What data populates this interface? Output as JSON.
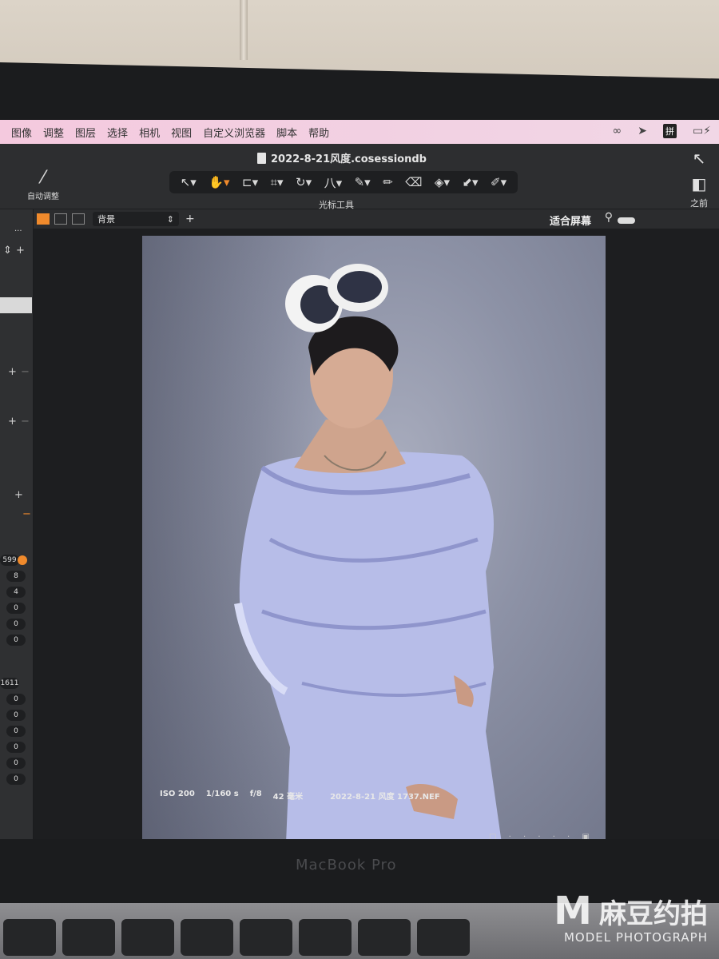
{
  "menubar": {
    "items": [
      "图像",
      "调整",
      "图层",
      "选择",
      "相机",
      "视图",
      "自定义浏览器",
      "脚本",
      "帮助"
    ],
    "tray": [
      "creative-cloud-icon",
      "send-icon",
      "拼",
      "battery-charging-icon"
    ],
    "tray_input_label": "拼"
  },
  "window": {
    "title": "2022-8-21风度.cosessiondb",
    "auto_adjust_label": "自动调整",
    "tool_caption": "光标工具",
    "before_label": "之前"
  },
  "toolbar": {
    "tools": [
      "select-icon",
      "pan-hand-icon",
      "loupe-icon",
      "crop-icon",
      "rotate-icon",
      "keystone-icon",
      "brush-icon",
      "eraser-icon",
      "gradient-icon",
      "stamp-icon",
      "picker-icon",
      "annotation-icon"
    ],
    "glyphs": [
      "↖▾",
      "✋▾",
      "⊏▾",
      "⌗▾",
      "↻▾",
      "八▾",
      "✎▾",
      "✏",
      "⌫",
      "◈▾",
      "⬋▾",
      "✐▾"
    ],
    "active_index": 1
  },
  "viewer": {
    "layer_select_value": "背景",
    "fit_label": "适合屏幕",
    "add_glyph": "+"
  },
  "left_panel": {
    "counts_upper": [
      "599",
      "8",
      "4",
      "0",
      "0",
      "0"
    ],
    "counts_lower": [
      "1611",
      "0",
      "0",
      "0",
      "0",
      "0",
      "0"
    ],
    "add_glyph": "+",
    "remove_glyph": "−",
    "more_glyph": "···"
  },
  "exif": {
    "iso": "ISO 200",
    "shutter": "1/160 s",
    "aperture": "f/8",
    "focal": "42 毫米",
    "filename": "2022-8-21 风度 1737.NEF"
  },
  "laptop": {
    "brand": "MacBook Pro"
  },
  "watermark": {
    "letter": "M",
    "cn": "麻豆约拍",
    "en": "MODEL PHOTOGRAPH"
  },
  "colors": {
    "accent": "#f08a2c",
    "menubar": "#f4c9de",
    "app_bg": "#2d2e30"
  }
}
